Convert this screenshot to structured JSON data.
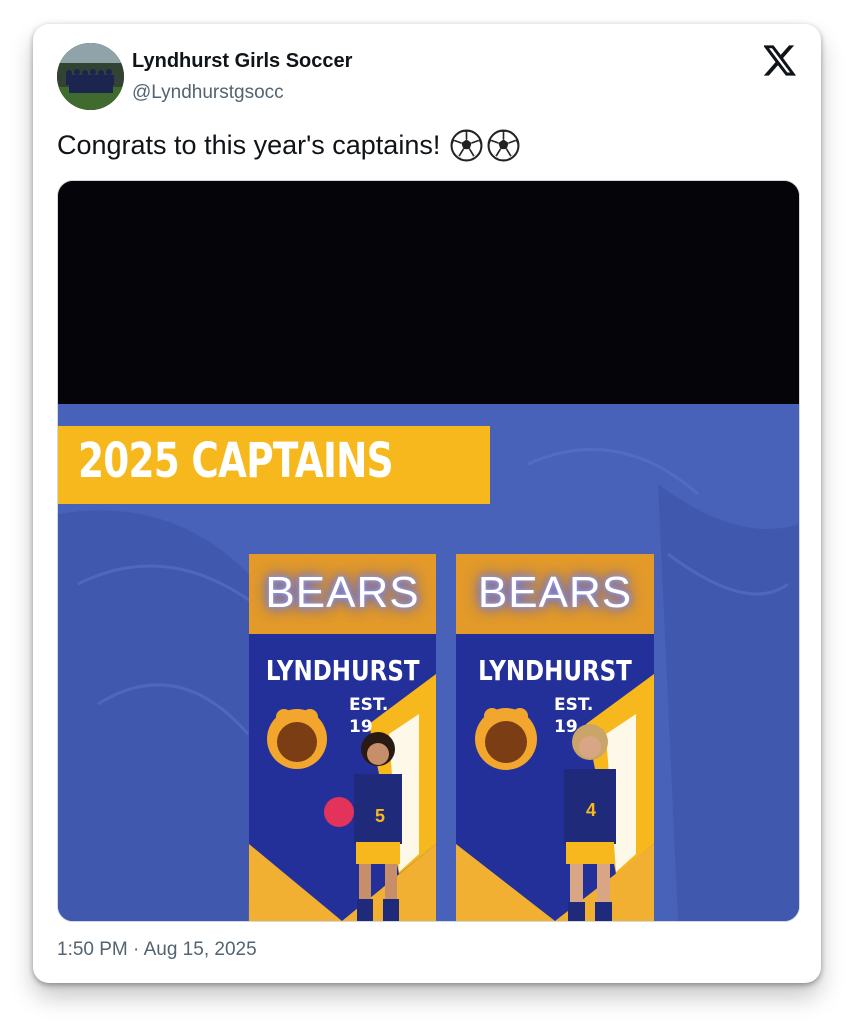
{
  "tweet": {
    "display_name": "Lyndhurst Girls Soccer",
    "handle": "@Lyndhurstgsocc",
    "text": "Congrats to this year's captains!",
    "text_emoji": "soccer-ball-icon soccer-ball-icon",
    "timestamp": "1:50 PM · Aug 15, 2025"
  },
  "media": {
    "banner_text": "2025 CAPTAINS",
    "panel_neon": "BEARS",
    "panel_school": "LYNDHURST",
    "panel_est": "EST.",
    "panel_est_year": "19",
    "jersey_number_left": "5",
    "jersey_number_right": "4",
    "colors": {
      "banner_yellow": "#f6b81c",
      "background_blue": "#4862ba",
      "navy": "#1f2a7a"
    }
  },
  "icons": {
    "brand": "x-logo-icon",
    "emoji": "soccer-ball-icon"
  }
}
